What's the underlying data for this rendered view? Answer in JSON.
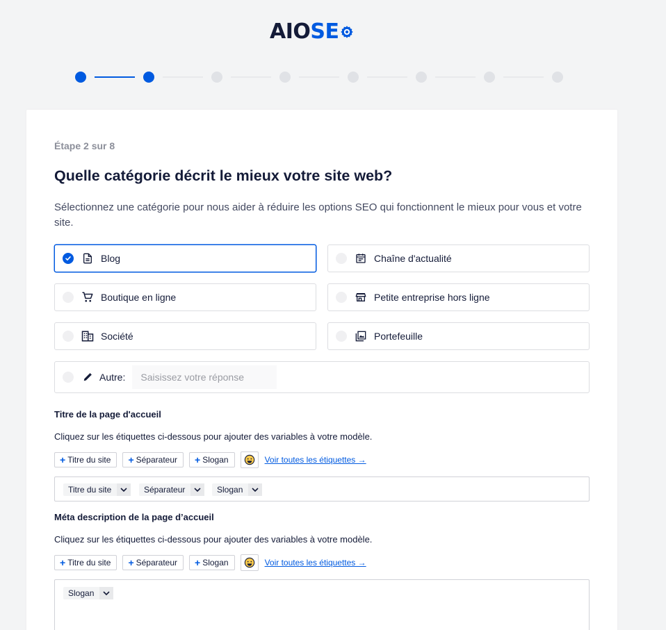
{
  "logo": {
    "part1": "AIO",
    "part2": "SE"
  },
  "stepper": {
    "total": 8,
    "current": 2
  },
  "step_label": "Étape 2 sur 8",
  "title": "Quelle catégorie décrit le mieux votre site web?",
  "description": "Sélectionnez une catégorie pour nous aider à réduire les options SEO qui fonctionnent le mieux pour vous et votre site.",
  "categories": [
    {
      "label": "Blog",
      "icon": "document-icon",
      "selected": true
    },
    {
      "label": "Chaîne d'actualité",
      "icon": "calendar-icon",
      "selected": false
    },
    {
      "label": "Boutique en ligne",
      "icon": "cart-icon",
      "selected": false
    },
    {
      "label": "Petite entreprise hors ligne",
      "icon": "storefront-icon",
      "selected": false
    },
    {
      "label": "Société",
      "icon": "building-icon",
      "selected": false
    },
    {
      "label": "Portefeuille",
      "icon": "gallery-icon",
      "selected": false
    }
  ],
  "other": {
    "label": "Autre:",
    "placeholder": "Saisissez votre réponse",
    "value": ""
  },
  "home_title": {
    "heading": "Titre de la page d'accueil",
    "help": "Cliquez sur les étiquettes ci-dessous pour ajouter des variables à votre modèle.",
    "tag_buttons": [
      "Titre du site",
      "Séparateur",
      "Slogan"
    ],
    "view_all": "Voir toutes les étiquettes →",
    "chips": [
      "Titre du site",
      "Séparateur",
      "Slogan"
    ]
  },
  "meta_description": {
    "heading": "Méta description de la page d’accueil",
    "help": "Cliquez sur les étiquettes ci-dessous pour ajouter des variables à votre modèle.",
    "tag_buttons": [
      "Titre du site",
      "Séparateur",
      "Slogan"
    ],
    "view_all": "Voir toutes les étiquettes →",
    "chips": [
      "Slogan"
    ]
  },
  "colors": {
    "accent": "#005ae0",
    "text": "#141b38",
    "muted": "#8c8f9a",
    "border": "#dcdde1"
  }
}
